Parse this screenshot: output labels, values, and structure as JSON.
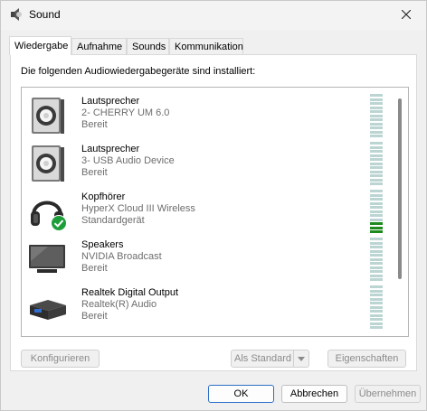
{
  "window": {
    "title": "Sound"
  },
  "tabs": [
    {
      "label": "Wiedergabe"
    },
    {
      "label": "Aufnahme"
    },
    {
      "label": "Sounds"
    },
    {
      "label": "Kommunikation"
    }
  ],
  "playback": {
    "heading": "Die folgenden Audiowiedergabegeräte sind installiert:",
    "devices": [
      {
        "name": "Lautsprecher",
        "description": "2- CHERRY UM 6.0",
        "status": "Bereit",
        "icon": "speaker-icon",
        "level": 0
      },
      {
        "name": "Lautsprecher",
        "description": "3- USB Audio Device",
        "status": "Bereit",
        "icon": "speaker-icon",
        "level": 0
      },
      {
        "name": "Kopfhörer",
        "description": "HyperX Cloud III Wireless",
        "status": "Standardgerät",
        "icon": "headphones-icon",
        "default": true,
        "level": 0.3
      },
      {
        "name": "Speakers",
        "description": "NVIDIA Broadcast",
        "status": "Bereit",
        "icon": "monitor-icon",
        "level": 0
      },
      {
        "name": "Realtek Digital Output",
        "description": "Realtek(R) Audio",
        "status": "Bereit",
        "icon": "digital-output-icon",
        "level": 0
      }
    ]
  },
  "buttons": {
    "configure": "Konfigurieren",
    "set_default": "Als Standard",
    "properties": "Eigenschaften",
    "ok": "OK",
    "cancel": "Abbrechen",
    "apply": "Übernehmen"
  },
  "colors": {
    "meter_on": "#1c8a1c",
    "meter_off": "#bcd5d3",
    "default_check": "#1e9e3a",
    "focus_border": "#2b6fc9"
  }
}
